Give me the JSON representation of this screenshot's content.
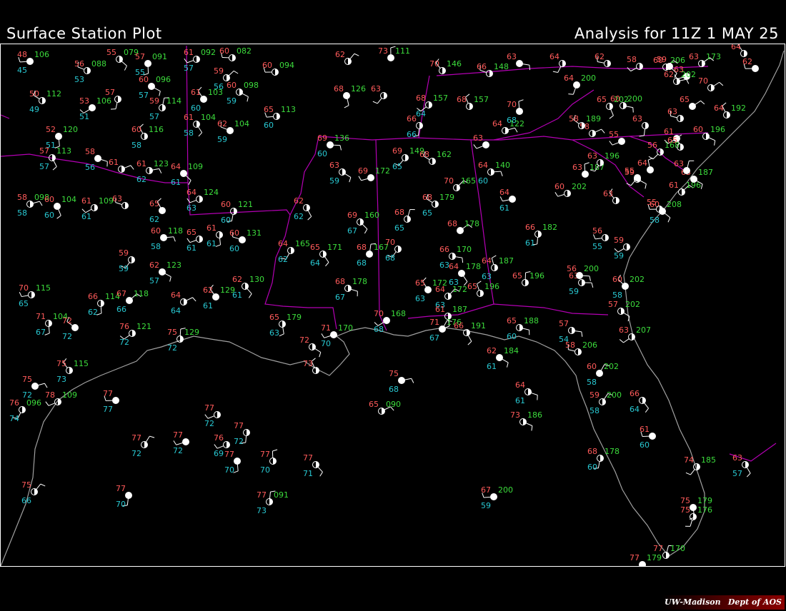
{
  "header": {
    "title": "Surface Station Plot",
    "analysis": "Analysis for 11Z  1 MAY 25"
  },
  "credit": {
    "left": "UW-Madison",
    "right": "Dept of AOS"
  },
  "colors": {
    "temperature": "#ff5a5a",
    "dewpoint": "#28c8d2",
    "pressure": "#3cdc3c",
    "weather": "#ffff00",
    "state_lines": "#b400b4",
    "coast": "#a0a0a0",
    "barb": "#ffffff"
  },
  "stations": [
    {
      "T": "48",
      "Td": "45",
      "P": "106"
    },
    {
      "T": "56",
      "Td": "53",
      "P": "088"
    },
    {
      "T": "55",
      "Td": "",
      "P": "079"
    },
    {
      "T": "57",
      "Td": "55",
      "P": "091"
    },
    {
      "T": "61",
      "Td": "57",
      "P": "092"
    },
    {
      "T": "60",
      "Td": "",
      "P": "082"
    },
    {
      "T": "60",
      "Td": "57",
      "P": "096"
    },
    {
      "T": "59",
      "Td": "56",
      "P": ""
    },
    {
      "T": "50",
      "Td": "49",
      "P": "112"
    },
    {
      "T": "53",
      "Td": "51",
      "P": "106"
    },
    {
      "T": "57",
      "Td": "",
      "P": ""
    },
    {
      "T": "59",
      "Td": "57",
      "P": "114"
    },
    {
      "T": "61",
      "Td": "60",
      "P": "103"
    },
    {
      "T": "60",
      "Td": "59",
      "P": "098"
    },
    {
      "T": "60",
      "Td": "",
      "P": "094"
    },
    {
      "T": "52",
      "Td": "51",
      "P": "120"
    },
    {
      "T": "60",
      "Td": "58",
      "P": "116"
    },
    {
      "T": "61",
      "Td": "58",
      "P": "104"
    },
    {
      "T": "62",
      "Td": "59",
      "P": "104"
    },
    {
      "T": "65",
      "Td": "60",
      "P": "113"
    },
    {
      "T": "57",
      "Td": "57",
      "P": "113"
    },
    {
      "T": "58",
      "Td": "56",
      "P": ""
    },
    {
      "T": "61",
      "Td": "",
      "P": ""
    },
    {
      "T": "61",
      "Td": "62",
      "P": "123"
    },
    {
      "T": "64",
      "Td": "61",
      "P": "109"
    },
    {
      "T": "64",
      "Td": "63",
      "P": "124"
    },
    {
      "T": "58",
      "Td": "58",
      "P": "098"
    },
    {
      "T": "60",
      "Td": "60",
      "P": "104"
    },
    {
      "T": "61",
      "Td": "61",
      "P": "109"
    },
    {
      "T": "63",
      "Td": "",
      "P": ""
    },
    {
      "T": "65",
      "Td": "62",
      "P": ""
    },
    {
      "T": "60",
      "Td": "60",
      "P": "121"
    },
    {
      "T": "62",
      "Td": "62",
      "P": ""
    },
    {
      "T": "60",
      "Td": "58",
      "P": "118"
    },
    {
      "T": "65",
      "Td": "61",
      "P": ""
    },
    {
      "T": "61",
      "Td": "61",
      "P": ""
    },
    {
      "T": "60",
      "Td": "60",
      "P": "131"
    },
    {
      "T": "64",
      "Td": "62",
      "P": "165"
    },
    {
      "T": "65",
      "Td": "64",
      "P": "171"
    },
    {
      "T": "68",
      "Td": "68",
      "P": "167"
    },
    {
      "T": "70",
      "Td": "68",
      "P": ""
    },
    {
      "T": "59",
      "Td": "59",
      "P": ""
    },
    {
      "T": "62",
      "Td": "57",
      "P": "123"
    },
    {
      "T": "64",
      "Td": "64",
      "P": ""
    },
    {
      "T": "66",
      "Td": "62",
      "P": "114"
    },
    {
      "T": "67",
      "Td": "66",
      "P": "118"
    },
    {
      "T": "70",
      "Td": "65",
      "P": "115"
    },
    {
      "T": "71",
      "Td": "67",
      "P": "104"
    },
    {
      "T": "72",
      "Td": "72",
      "P": ""
    },
    {
      "T": "76",
      "Td": "72",
      "P": "121"
    },
    {
      "T": "75",
      "Td": "72",
      "P": "129"
    },
    {
      "T": "62",
      "Td": "61",
      "P": "129"
    },
    {
      "T": "62",
      "Td": "61",
      "P": "130"
    },
    {
      "T": "65",
      "Td": "63",
      "P": "179"
    },
    {
      "T": "71",
      "Td": "70",
      "P": "170"
    },
    {
      "T": "72",
      "Td": "",
      "P": ""
    },
    {
      "T": "68",
      "Td": "67",
      "P": "178"
    },
    {
      "T": "70",
      "Td": "68",
      "P": "168"
    },
    {
      "T": "73",
      "Td": "",
      "P": ""
    },
    {
      "T": "75",
      "Td": "73",
      "P": "115"
    },
    {
      "T": "75",
      "Td": "72",
      "P": ""
    },
    {
      "T": "76",
      "Td": "74",
      "P": "096"
    },
    {
      "T": "78",
      "Td": "",
      "P": "109"
    },
    {
      "T": "77",
      "Td": "77",
      "P": ""
    },
    {
      "T": "77",
      "Td": "72",
      "P": ""
    },
    {
      "T": "77",
      "Td": "72",
      "P": ""
    },
    {
      "T": "77",
      "Td": "72",
      "P": ""
    },
    {
      "T": "76",
      "Td": "69",
      "P": ""
    },
    {
      "T": "77",
      "Td": "72",
      "P": ""
    },
    {
      "T": "77",
      "Td": "70",
      "P": ""
    },
    {
      "T": "77",
      "Td": "70",
      "P": ""
    },
    {
      "T": "77",
      "Td": "71",
      "P": ""
    },
    {
      "T": "77",
      "Td": "70",
      "P": ""
    },
    {
      "T": "77",
      "Td": "73",
      "P": "091"
    },
    {
      "T": "75",
      "Td": "66",
      "P": ""
    },
    {
      "T": "75",
      "Td": "68",
      "P": ""
    },
    {
      "T": "65",
      "Td": "",
      "P": "090"
    },
    {
      "T": "62",
      "Td": "",
      "P": ""
    },
    {
      "T": "73",
      "Td": "",
      "P": "111"
    },
    {
      "T": "70",
      "Td": "",
      "P": "146"
    },
    {
      "T": "66",
      "Td": "",
      "P": "148"
    },
    {
      "T": "63",
      "Td": "",
      "P": ""
    },
    {
      "T": "64",
      "Td": "",
      "P": ""
    },
    {
      "T": "63",
      "Td": "",
      "P": ""
    },
    {
      "T": "68",
      "Td": "",
      "P": "126"
    },
    {
      "T": "68",
      "Td": "64",
      "P": "157"
    },
    {
      "T": "68",
      "Td": "",
      "P": "157"
    },
    {
      "T": "70",
      "Td": "68",
      "P": ""
    },
    {
      "T": "66",
      "Td": "66",
      "P": ""
    },
    {
      "T": "64",
      "Td": "",
      "P": "122"
    },
    {
      "T": "69",
      "Td": "60",
      "P": "136"
    },
    {
      "T": "69",
      "Td": "65",
      "P": "149"
    },
    {
      "T": "68",
      "Td": "",
      "P": "162"
    },
    {
      "T": "63",
      "Td": "",
      "P": ""
    },
    {
      "T": "63",
      "Td": "59",
      "P": ""
    },
    {
      "T": "64",
      "Td": "60",
      "P": "140"
    },
    {
      "T": "69",
      "Td": "",
      "P": "172"
    },
    {
      "T": "70",
      "Td": "",
      "P": "165"
    },
    {
      "T": "68",
      "Td": "65",
      "P": "179"
    },
    {
      "T": "64",
      "Td": "61",
      "P": ""
    },
    {
      "T": "69",
      "Td": "67",
      "P": "160"
    },
    {
      "T": "68",
      "Td": "65",
      "P": ""
    },
    {
      "T": "68",
      "Td": "",
      "P": "178"
    },
    {
      "T": "66",
      "Td": "61",
      "P": "182"
    },
    {
      "T": "66",
      "Td": "63",
      "P": "170"
    },
    {
      "T": "64",
      "Td": "63",
      "P": "178"
    },
    {
      "T": "64",
      "Td": "63",
      "P": "187"
    },
    {
      "T": "65",
      "Td": "",
      "P": "196"
    },
    {
      "T": "65",
      "Td": "63",
      "P": "172"
    },
    {
      "T": "64",
      "Td": "63",
      "P": "172"
    },
    {
      "T": "61",
      "Td": "",
      "P": "187"
    },
    {
      "T": "71",
      "Td": "67",
      "P": "176"
    },
    {
      "T": "66",
      "Td": "",
      "P": "191"
    },
    {
      "T": "65",
      "Td": "60",
      "P": "188"
    },
    {
      "T": "62",
      "Td": "61",
      "P": "184"
    },
    {
      "T": "57",
      "Td": "54",
      "P": ""
    },
    {
      "T": "58",
      "Td": "",
      "P": "206"
    },
    {
      "T": "60",
      "Td": "58",
      "P": "202"
    },
    {
      "T": "59",
      "Td": "58",
      "P": "200"
    },
    {
      "T": "66",
      "Td": "64",
      "P": ""
    },
    {
      "T": "61",
      "Td": "60",
      "P": ""
    },
    {
      "T": "64",
      "Td": "61",
      "P": ""
    },
    {
      "T": "68",
      "Td": "60",
      "P": "178"
    },
    {
      "T": "67",
      "Td": "59",
      "P": "200"
    },
    {
      "T": "73",
      "Td": "",
      "P": "186"
    },
    {
      "T": "74",
      "Td": "",
      "P": "185"
    },
    {
      "T": "75",
      "Td": "",
      "P": "179"
    },
    {
      "T": "75",
      "Td": "",
      "P": "176"
    },
    {
      "T": "77",
      "Td": "",
      "P": "170"
    },
    {
      "T": "77",
      "Td": "",
      "P": "179"
    },
    {
      "T": "63",
      "Td": "57",
      "P": ""
    },
    {
      "T": "63",
      "Td": "59",
      "P": ""
    },
    {
      "T": "60",
      "Td": "58",
      "P": "202"
    },
    {
      "T": "57",
      "Td": "",
      "P": "202"
    },
    {
      "T": "63",
      "Td": "",
      "P": "207"
    },
    {
      "T": "60",
      "Td": "58",
      "P": "208"
    },
    {
      "T": "56",
      "Td": "55",
      "P": ""
    },
    {
      "T": "59",
      "Td": "59",
      "P": ""
    },
    {
      "T": "56",
      "Td": "",
      "P": "200"
    },
    {
      "T": "65",
      "Td": "",
      "P": "196"
    },
    {
      "T": "60",
      "Td": "",
      "P": "202"
    },
    {
      "T": "63",
      "Td": "",
      "P": "187"
    },
    {
      "T": "63",
      "Td": "",
      "P": "196"
    },
    {
      "T": "58",
      "Td": "",
      "P": ""
    },
    {
      "T": "64",
      "Td": "",
      "P": ""
    },
    {
      "T": "63",
      "Td": "",
      "P": ""
    },
    {
      "T": "63",
      "Td": "",
      "P": ""
    },
    {
      "T": "55",
      "Td": "",
      "P": ""
    },
    {
      "T": "59",
      "Td": "",
      "P": ""
    },
    {
      "T": "61",
      "Td": "",
      "P": "196"
    },
    {
      "T": "63",
      "Td": "",
      "P": "187"
    },
    {
      "T": "60",
      "Td": "",
      "P": "196"
    },
    {
      "T": "65",
      "Td": "",
      "P": "202"
    },
    {
      "T": "64",
      "Td": "",
      "P": "200"
    },
    {
      "T": "60",
      "Td": "",
      "P": "200"
    },
    {
      "T": "58",
      "Td": "",
      "P": "189"
    },
    {
      "T": "55",
      "Td": "",
      "P": ""
    },
    {
      "T": "56",
      "Td": "",
      "P": "168"
    },
    {
      "T": "63",
      "Td": "",
      "P": ""
    },
    {
      "T": "65",
      "Td": "",
      "P": ""
    },
    {
      "T": "62",
      "Td": "",
      "P": ""
    },
    {
      "T": "58",
      "Td": "",
      "P": ""
    },
    {
      "T": "59",
      "Td": "",
      "P": ""
    },
    {
      "T": "63",
      "Td": "",
      "P": "173"
    },
    {
      "T": "64",
      "Td": "",
      "P": ""
    },
    {
      "T": "62",
      "Td": "",
      "P": ""
    },
    {
      "T": "70",
      "Td": "",
      "P": ""
    },
    {
      "T": "64",
      "Td": "",
      "P": "192"
    },
    {
      "T": "63",
      "Td": "",
      "P": ""
    },
    {
      "T": "62",
      "Td": "",
      "P": "202"
    },
    {
      "T": "60",
      "Td": "",
      "P": "206"
    },
    {
      "T": "61",
      "Td": "",
      "P": ""
    },
    {
      "T": "55",
      "Td": "",
      "P": ""
    },
    {
      "T": "65",
      "Td": "",
      "P": ""
    },
    {
      "T": "63",
      "Td": "",
      "P": ""
    }
  ]
}
